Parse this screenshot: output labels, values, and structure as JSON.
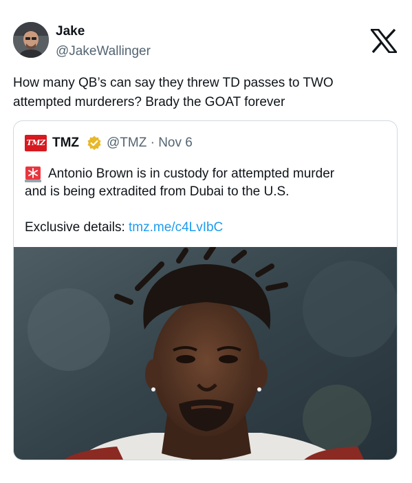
{
  "author": {
    "name": "Jake",
    "handle": "@JakeWallinger"
  },
  "icons": {
    "brand": "x-logo-icon",
    "verified": "verified-badge-icon",
    "siren": "rotating-light-icon"
  },
  "tweet": {
    "text": "How many QB’s can say they threw TD passes to TWO\nattempted murderers? Brady the GOAT forever"
  },
  "quoted": {
    "logo_text": "TMZ",
    "name": "TMZ",
    "handle_date": "@TMZ · Nov 6",
    "text_line1": "Antonio Brown is in custody for attempted murder",
    "text_line2": "and is being extradited from Dubai to the U.S.",
    "exclusive_label": "Exclusive details: ",
    "link": "tmz.me/c4LvIbC"
  },
  "colors": {
    "text": "#0f1419",
    "secondary_text": "#536471",
    "link": "#1d9bf0",
    "border": "#cfd9de",
    "tmz_red": "#d71920",
    "verified_gold": "#e8b829"
  }
}
